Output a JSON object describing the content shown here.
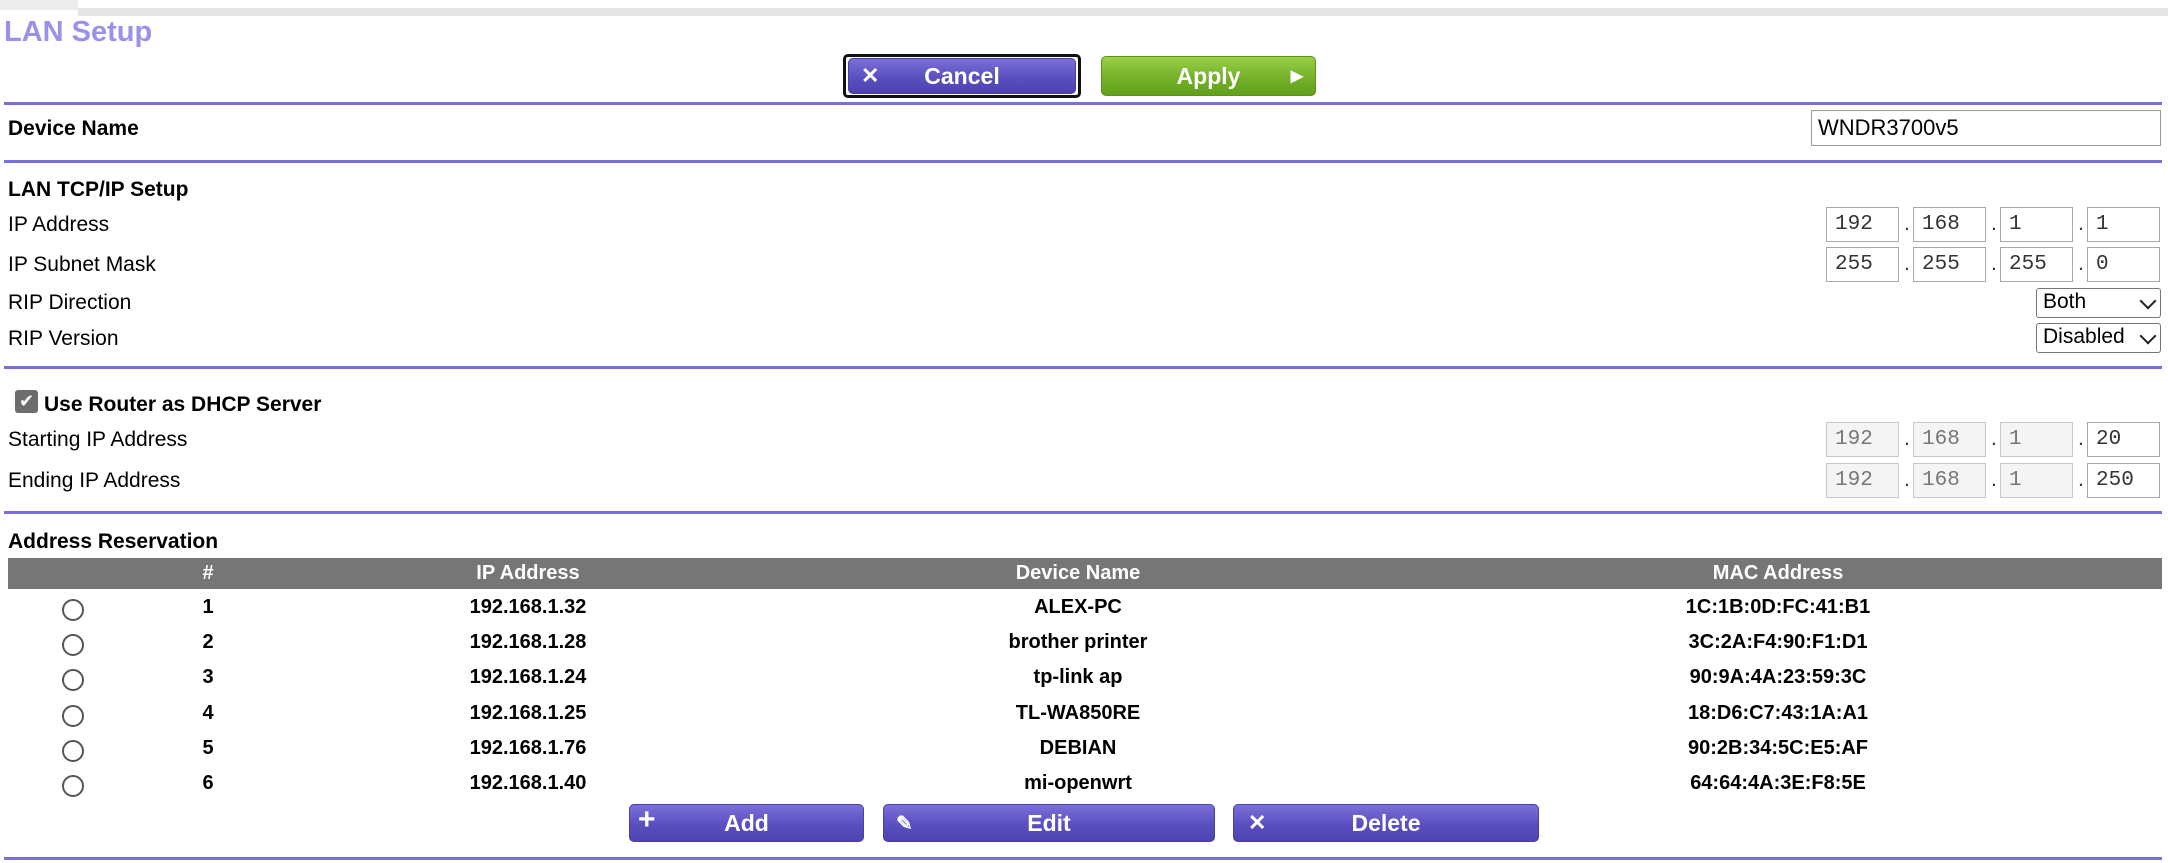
{
  "page": {
    "title": "LAN Setup"
  },
  "actions": {
    "cancel": "Cancel",
    "apply": "Apply"
  },
  "device": {
    "label": "Device Name",
    "value": "WNDR3700v5"
  },
  "lan": {
    "heading": "LAN TCP/IP Setup",
    "ip_label": "IP Address",
    "ip": [
      "192",
      "168",
      "1",
      "1"
    ],
    "mask_label": "IP Subnet Mask",
    "mask": [
      "255",
      "255",
      "255",
      "0"
    ],
    "rip_dir_label": "RIP Direction",
    "rip_dir": "Both",
    "rip_ver_label": "RIP Version",
    "rip_ver": "Disabled"
  },
  "dhcp": {
    "label": "Use Router as DHCP Server",
    "checked": true,
    "start_label": "Starting IP Address",
    "start": [
      "192",
      "168",
      "1",
      "20"
    ],
    "end_label": "Ending IP Address",
    "end": [
      "192",
      "168",
      "1",
      "250"
    ]
  },
  "reservation": {
    "heading": "Address Reservation",
    "columns": [
      "#",
      "IP Address",
      "Device Name",
      "MAC Address"
    ],
    "rows": [
      {
        "n": "1",
        "ip": "192.168.1.32",
        "name": "ALEX-PC",
        "mac": "1C:1B:0D:FC:41:B1"
      },
      {
        "n": "2",
        "ip": "192.168.1.28",
        "name": "brother printer",
        "mac": "3C:2A:F4:90:F1:D1"
      },
      {
        "n": "3",
        "ip": "192.168.1.24",
        "name": "tp-link ap",
        "mac": "90:9A:4A:23:59:3C"
      },
      {
        "n": "4",
        "ip": "192.168.1.25",
        "name": "TL-WA850RE",
        "mac": "18:D6:C7:43:1A:A1"
      },
      {
        "n": "5",
        "ip": "192.168.1.76",
        "name": "DEBIAN",
        "mac": "90:2B:34:5C:E5:AF"
      },
      {
        "n": "6",
        "ip": "192.168.1.40",
        "name": "mi-openwrt",
        "mac": "64:64:4A:3E:F8:5E"
      }
    ],
    "add": "Add",
    "edit": "Edit",
    "delete": "Delete"
  },
  "colors": {
    "accent": "#7a6fe0",
    "title": "#9a92ea",
    "apply": "#74b028",
    "header": "#767676"
  }
}
